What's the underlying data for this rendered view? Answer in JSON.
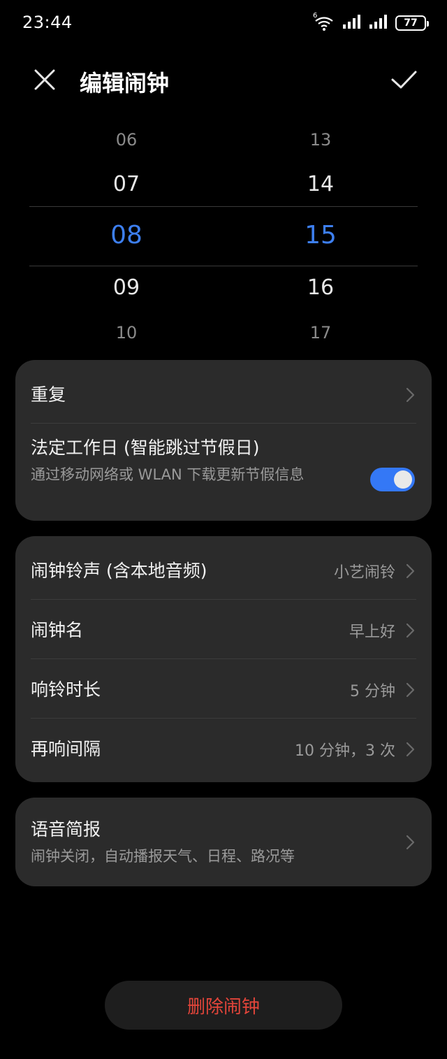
{
  "status_bar": {
    "time": "23:44",
    "wifi_label": "6",
    "battery": "77"
  },
  "header": {
    "title": "编辑闹钟"
  },
  "picker": {
    "hours": [
      "06",
      "07",
      "08",
      "09",
      "10"
    ],
    "minutes": [
      "13",
      "14",
      "15",
      "16",
      "17"
    ],
    "selected_color": "#3d7ff0"
  },
  "repeat_card": {
    "repeat_label": "重复",
    "workday_label": "法定工作日 (智能跳过节假日)",
    "workday_sub": "通过移动网络或 WLAN 下载更新节假信息",
    "workday_enabled": true
  },
  "settings_card": {
    "ringtone_label": "闹钟铃声 (含本地音频)",
    "ringtone_value": "小艺闹铃",
    "name_label": "闹钟名",
    "name_value": "早上好",
    "duration_label": "响铃时长",
    "duration_value": "5 分钟",
    "snooze_label": "再响间隔",
    "snooze_value": "10 分钟，3 次"
  },
  "voice_card": {
    "label": "语音简报",
    "sub": "闹钟关闭，自动播报天气、日程、路况等"
  },
  "delete_button": {
    "label": "删除闹钟",
    "color": "#e3453a"
  },
  "colors": {
    "accent": "#3478f6",
    "card_bg": "#2b2b2b",
    "background": "#000000"
  }
}
